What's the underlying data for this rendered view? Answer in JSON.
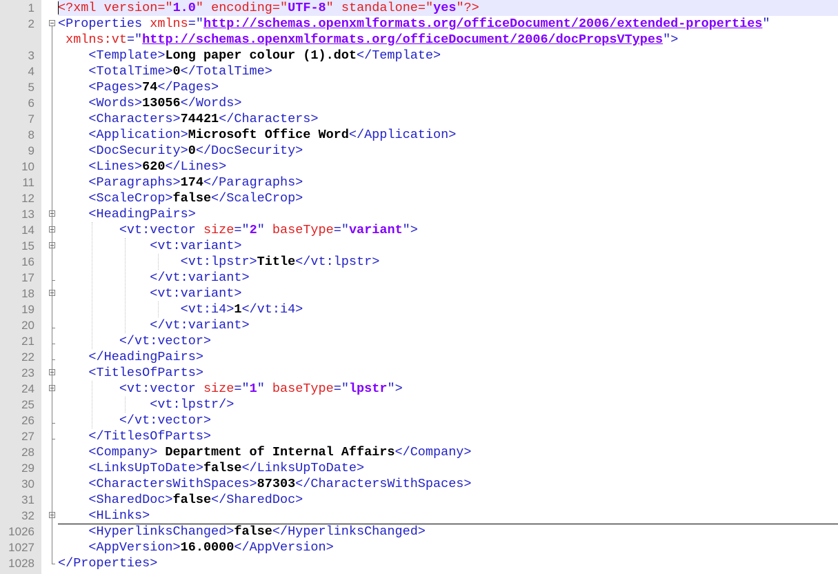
{
  "editor": {
    "lines": [
      {
        "no": "1",
        "segments": [
          {
            "t": "pi",
            "v": "<?xml "
          },
          {
            "t": "attr",
            "v": "version"
          },
          {
            "t": "pi",
            "v": "=\""
          },
          {
            "t": "str",
            "v": "1.0"
          },
          {
            "t": "pi",
            "v": "\" "
          },
          {
            "t": "attr",
            "v": "encoding"
          },
          {
            "t": "pi",
            "v": "=\""
          },
          {
            "t": "str",
            "v": "UTF-8"
          },
          {
            "t": "pi",
            "v": "\" "
          },
          {
            "t": "attr",
            "v": "standalone"
          },
          {
            "t": "pi",
            "v": "=\""
          },
          {
            "t": "str",
            "v": "yes"
          },
          {
            "t": "pi",
            "v": "\"?>"
          }
        ]
      },
      {
        "no": "2",
        "segments": [
          {
            "t": "tag",
            "v": "<Properties "
          },
          {
            "t": "attr",
            "v": "xmlns"
          },
          {
            "t": "tag",
            "v": "=\""
          },
          {
            "t": "url",
            "v": "http://schemas.openxmlformats.org/officeDocument/2006/extended-properties"
          },
          {
            "t": "tag",
            "v": "\""
          }
        ]
      },
      {
        "no": "",
        "segments": [
          {
            "t": "tag",
            "v": " "
          },
          {
            "t": "attr",
            "v": "xmlns:vt"
          },
          {
            "t": "tag",
            "v": "=\""
          },
          {
            "t": "url",
            "v": "http://schemas.openxmlformats.org/officeDocument/2006/docPropsVTypes"
          },
          {
            "t": "tag",
            "v": "\">"
          }
        ]
      },
      {
        "no": "3",
        "segments": [
          {
            "t": "tag",
            "v": "    <Template>"
          },
          {
            "t": "txt",
            "v": "Long paper colour (1).dot"
          },
          {
            "t": "tag",
            "v": "</Template>"
          }
        ]
      },
      {
        "no": "4",
        "segments": [
          {
            "t": "tag",
            "v": "    <TotalTime>"
          },
          {
            "t": "txt",
            "v": "0"
          },
          {
            "t": "tag",
            "v": "</TotalTime>"
          }
        ]
      },
      {
        "no": "5",
        "segments": [
          {
            "t": "tag",
            "v": "    <Pages>"
          },
          {
            "t": "txt",
            "v": "74"
          },
          {
            "t": "tag",
            "v": "</Pages>"
          }
        ]
      },
      {
        "no": "6",
        "segments": [
          {
            "t": "tag",
            "v": "    <Words>"
          },
          {
            "t": "txt",
            "v": "13056"
          },
          {
            "t": "tag",
            "v": "</Words>"
          }
        ]
      },
      {
        "no": "7",
        "segments": [
          {
            "t": "tag",
            "v": "    <Characters>"
          },
          {
            "t": "txt",
            "v": "74421"
          },
          {
            "t": "tag",
            "v": "</Characters>"
          }
        ]
      },
      {
        "no": "8",
        "segments": [
          {
            "t": "tag",
            "v": "    <Application>"
          },
          {
            "t": "txt",
            "v": "Microsoft Office Word"
          },
          {
            "t": "tag",
            "v": "</Application>"
          }
        ]
      },
      {
        "no": "9",
        "segments": [
          {
            "t": "tag",
            "v": "    <DocSecurity>"
          },
          {
            "t": "txt",
            "v": "0"
          },
          {
            "t": "tag",
            "v": "</DocSecurity>"
          }
        ]
      },
      {
        "no": "10",
        "segments": [
          {
            "t": "tag",
            "v": "    <Lines>"
          },
          {
            "t": "txt",
            "v": "620"
          },
          {
            "t": "tag",
            "v": "</Lines>"
          }
        ]
      },
      {
        "no": "11",
        "segments": [
          {
            "t": "tag",
            "v": "    <Paragraphs>"
          },
          {
            "t": "txt",
            "v": "174"
          },
          {
            "t": "tag",
            "v": "</Paragraphs>"
          }
        ]
      },
      {
        "no": "12",
        "segments": [
          {
            "t": "tag",
            "v": "    <ScaleCrop>"
          },
          {
            "t": "txt",
            "v": "false"
          },
          {
            "t": "tag",
            "v": "</ScaleCrop>"
          }
        ]
      },
      {
        "no": "13",
        "segments": [
          {
            "t": "tag",
            "v": "    <HeadingPairs>"
          }
        ]
      },
      {
        "no": "14",
        "segments": [
          {
            "t": "tag",
            "v": "        <vt:vector "
          },
          {
            "t": "attr",
            "v": "size"
          },
          {
            "t": "tag",
            "v": "=\""
          },
          {
            "t": "str",
            "v": "2"
          },
          {
            "t": "tag",
            "v": "\" "
          },
          {
            "t": "attr",
            "v": "baseType"
          },
          {
            "t": "tag",
            "v": "=\""
          },
          {
            "t": "str",
            "v": "variant"
          },
          {
            "t": "tag",
            "v": "\">"
          }
        ]
      },
      {
        "no": "15",
        "segments": [
          {
            "t": "tag",
            "v": "            <vt:variant>"
          }
        ]
      },
      {
        "no": "16",
        "segments": [
          {
            "t": "tag",
            "v": "                <vt:lpstr>"
          },
          {
            "t": "txt",
            "v": "Title"
          },
          {
            "t": "tag",
            "v": "</vt:lpstr>"
          }
        ]
      },
      {
        "no": "17",
        "segments": [
          {
            "t": "tag",
            "v": "            </vt:variant>"
          }
        ]
      },
      {
        "no": "18",
        "segments": [
          {
            "t": "tag",
            "v": "            <vt:variant>"
          }
        ]
      },
      {
        "no": "19",
        "segments": [
          {
            "t": "tag",
            "v": "                <vt:i4>"
          },
          {
            "t": "txt",
            "v": "1"
          },
          {
            "t": "tag",
            "v": "</vt:i4>"
          }
        ]
      },
      {
        "no": "20",
        "segments": [
          {
            "t": "tag",
            "v": "            </vt:variant>"
          }
        ]
      },
      {
        "no": "21",
        "segments": [
          {
            "t": "tag",
            "v": "        </vt:vector>"
          }
        ]
      },
      {
        "no": "22",
        "segments": [
          {
            "t": "tag",
            "v": "    </HeadingPairs>"
          }
        ]
      },
      {
        "no": "23",
        "segments": [
          {
            "t": "tag",
            "v": "    <TitlesOfParts>"
          }
        ]
      },
      {
        "no": "24",
        "segments": [
          {
            "t": "tag",
            "v": "        <vt:vector "
          },
          {
            "t": "attr",
            "v": "size"
          },
          {
            "t": "tag",
            "v": "=\""
          },
          {
            "t": "str",
            "v": "1"
          },
          {
            "t": "tag",
            "v": "\" "
          },
          {
            "t": "attr",
            "v": "baseType"
          },
          {
            "t": "tag",
            "v": "=\""
          },
          {
            "t": "str",
            "v": "lpstr"
          },
          {
            "t": "tag",
            "v": "\">"
          }
        ]
      },
      {
        "no": "25",
        "segments": [
          {
            "t": "tag",
            "v": "            <vt:lpstr/>"
          }
        ]
      },
      {
        "no": "26",
        "segments": [
          {
            "t": "tag",
            "v": "        </vt:vector>"
          }
        ]
      },
      {
        "no": "27",
        "segments": [
          {
            "t": "tag",
            "v": "    </TitlesOfParts>"
          }
        ]
      },
      {
        "no": "28",
        "segments": [
          {
            "t": "tag",
            "v": "    <Company>"
          },
          {
            "t": "txt",
            "v": " Department of Internal Affairs"
          },
          {
            "t": "tag",
            "v": "</Company>"
          }
        ]
      },
      {
        "no": "29",
        "segments": [
          {
            "t": "tag",
            "v": "    <LinksUpToDate>"
          },
          {
            "t": "txt",
            "v": "false"
          },
          {
            "t": "tag",
            "v": "</LinksUpToDate>"
          }
        ]
      },
      {
        "no": "30",
        "segments": [
          {
            "t": "tag",
            "v": "    <CharactersWithSpaces>"
          },
          {
            "t": "txt",
            "v": "87303"
          },
          {
            "t": "tag",
            "v": "</CharactersWithSpaces>"
          }
        ]
      },
      {
        "no": "31",
        "segments": [
          {
            "t": "tag",
            "v": "    <SharedDoc>"
          },
          {
            "t": "txt",
            "v": "false"
          },
          {
            "t": "tag",
            "v": "</SharedDoc>"
          }
        ]
      },
      {
        "no": "32",
        "segments": [
          {
            "t": "tag",
            "v": "    <HLinks>"
          }
        ]
      },
      {
        "no": "1026",
        "segments": [
          {
            "t": "tag",
            "v": "    <HyperlinksChanged>"
          },
          {
            "t": "txt",
            "v": "false"
          },
          {
            "t": "tag",
            "v": "</HyperlinksChanged>"
          }
        ]
      },
      {
        "no": "1027",
        "segments": [
          {
            "t": "tag",
            "v": "    <AppVersion>"
          },
          {
            "t": "txt",
            "v": "16.0000"
          },
          {
            "t": "tag",
            "v": "</AppVersion>"
          }
        ]
      },
      {
        "no": "1028",
        "segments": [
          {
            "t": "tag",
            "v": "</Properties>"
          }
        ]
      }
    ]
  },
  "colors": {
    "tag": "#2323c8",
    "attribute": "#e02020",
    "string": "#8000ff",
    "text": "#000000",
    "gutter_background": "#e4e4e4",
    "current_line": "#e8e8ff"
  }
}
